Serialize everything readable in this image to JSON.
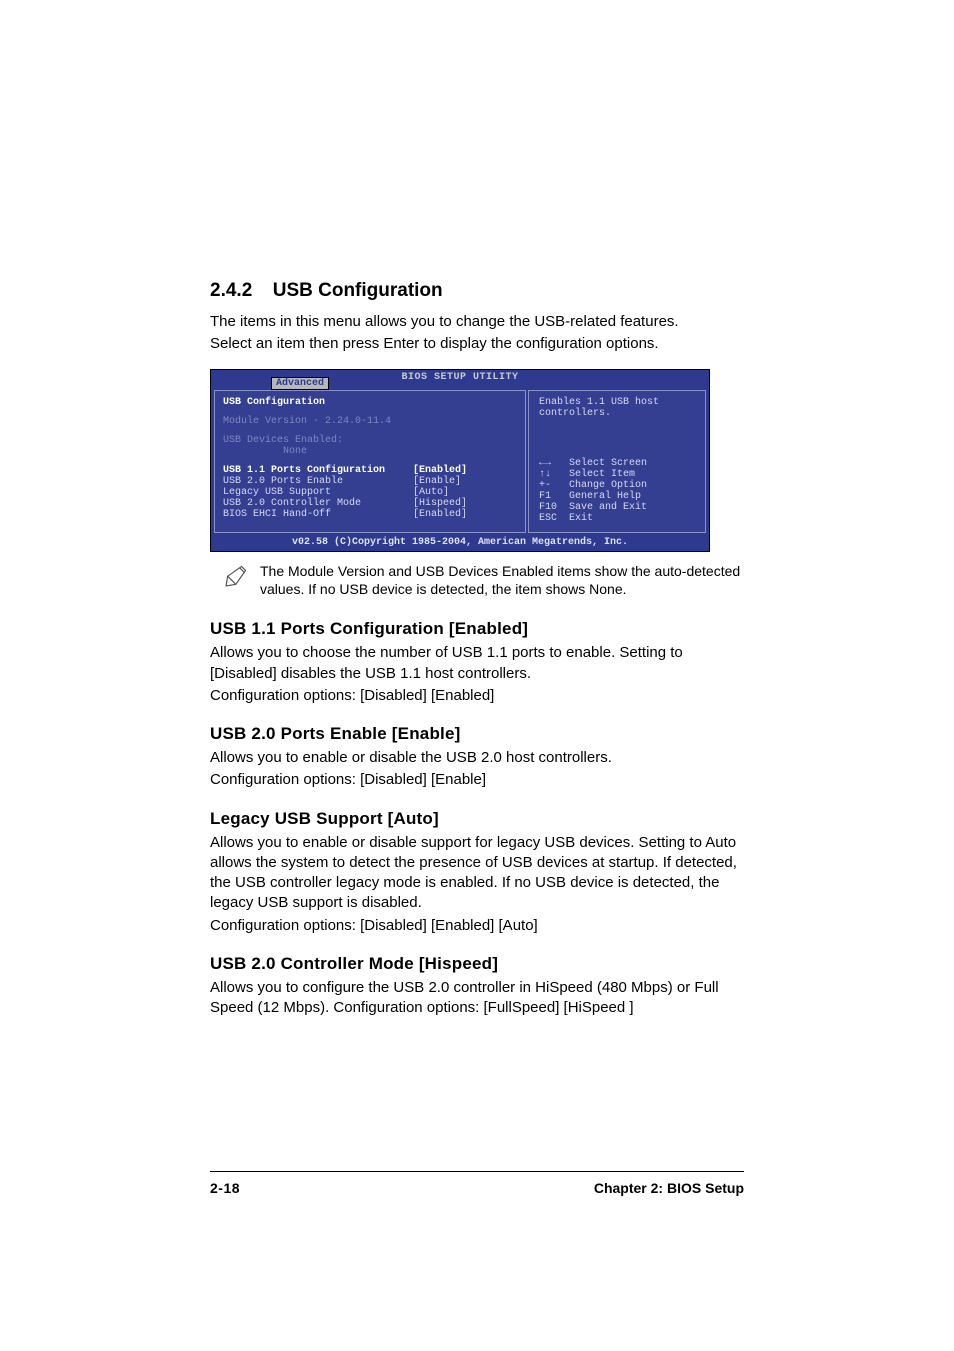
{
  "heading": {
    "number": "2.4.2",
    "title": "USB Configuration"
  },
  "intro": [
    "The items in this menu allows you to change the USB-related features.",
    "Select an item then press Enter to display the configuration options."
  ],
  "bios": {
    "title": "BIOS SETUP UTILITY",
    "tab": "Advanced",
    "left": {
      "header": "USB Configuration",
      "module_label": "Module Version - 2.24.0-11.4",
      "devices_label": "USB Devices Enabled:",
      "devices_value": "None",
      "items": [
        {
          "label": "USB 1.1 Ports Configuration",
          "value": "[Enabled]",
          "white": true
        },
        {
          "label": "USB 2.0 Ports Enable",
          "value": "[Enable]"
        },
        {
          "label": "Legacy USB Support",
          "value": "[Auto]"
        },
        {
          "label": "USB 2.0 Controller Mode",
          "value": "[Hispeed]"
        },
        {
          "label": "BIOS EHCI Hand-Off",
          "value": "[Enabled]"
        }
      ]
    },
    "right": {
      "help": "Enables 1.1 USB host controllers.",
      "legend": [
        {
          "key": "←→",
          "text": "Select Screen"
        },
        {
          "key": "↑↓",
          "text": "Select Item"
        },
        {
          "key": "+-",
          "text": "Change Option"
        },
        {
          "key": "F1",
          "text": "General Help"
        },
        {
          "key": "F10",
          "text": "Save and Exit"
        },
        {
          "key": "ESC",
          "text": "Exit"
        }
      ]
    },
    "footer": "v02.58 (C)Copyright 1985-2004, American Megatrends, Inc."
  },
  "note": "The Module Version and USB Devices Enabled items show the auto-detected values. If no USB device is detected, the item shows None.",
  "sections": [
    {
      "title": "USB 1.1 Ports Configuration [Enabled]",
      "body": [
        "Allows you to choose the number of USB 1.1 ports to enable. Setting to [Disabled] disables the USB 1.1 host controllers.",
        "Configuration options: [Disabled] [Enabled]"
      ]
    },
    {
      "title": "USB 2.0 Ports Enable [Enable]",
      "body": [
        "Allows you to enable or disable the USB 2.0 host controllers.",
        "Configuration options: [Disabled] [Enable]"
      ]
    },
    {
      "title": "Legacy USB Support [Auto]",
      "body": [
        "Allows you to enable or disable support for legacy USB devices. Setting to Auto allows the system to detect the presence of USB devices at startup. If detected, the USB controller legacy mode is enabled. If no USB device is detected, the legacy USB support is disabled.",
        "Configuration options: [Disabled] [Enabled] [Auto]"
      ]
    },
    {
      "title": "USB 2.0 Controller Mode [Hispeed]",
      "body": [
        "Allows you to configure the USB 2.0 controller in HiSpeed (480 Mbps) or Full Speed (12 Mbps). Configuration options: [FullSpeed] [HiSpeed ]"
      ]
    }
  ],
  "footer": {
    "page": "2-18",
    "chapter": "Chapter 2: BIOS Setup"
  }
}
